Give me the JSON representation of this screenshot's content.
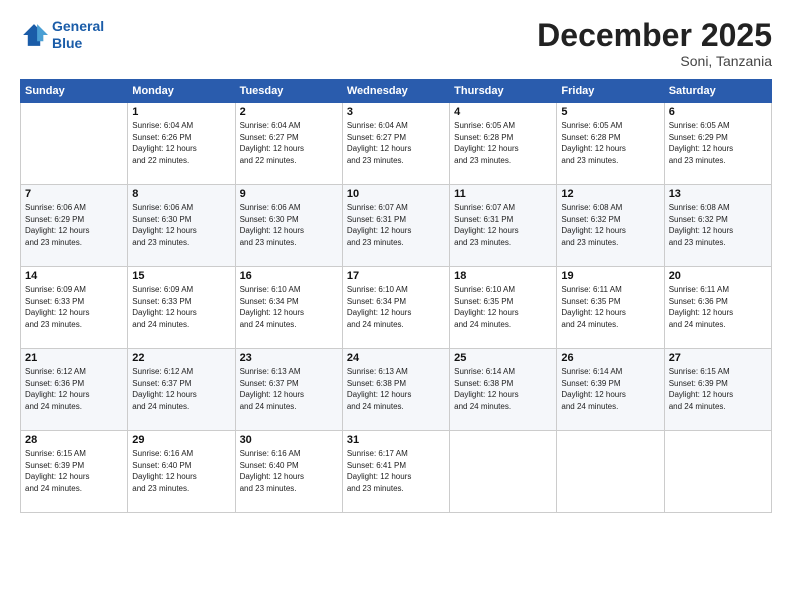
{
  "header": {
    "logo_line1": "General",
    "logo_line2": "Blue",
    "month": "December 2025",
    "location": "Soni, Tanzania"
  },
  "days_of_week": [
    "Sunday",
    "Monday",
    "Tuesday",
    "Wednesday",
    "Thursday",
    "Friday",
    "Saturday"
  ],
  "weeks": [
    [
      {
        "day": "",
        "info": ""
      },
      {
        "day": "1",
        "info": "Sunrise: 6:04 AM\nSunset: 6:26 PM\nDaylight: 12 hours\nand 22 minutes."
      },
      {
        "day": "2",
        "info": "Sunrise: 6:04 AM\nSunset: 6:27 PM\nDaylight: 12 hours\nand 22 minutes."
      },
      {
        "day": "3",
        "info": "Sunrise: 6:04 AM\nSunset: 6:27 PM\nDaylight: 12 hours\nand 23 minutes."
      },
      {
        "day": "4",
        "info": "Sunrise: 6:05 AM\nSunset: 6:28 PM\nDaylight: 12 hours\nand 23 minutes."
      },
      {
        "day": "5",
        "info": "Sunrise: 6:05 AM\nSunset: 6:28 PM\nDaylight: 12 hours\nand 23 minutes."
      },
      {
        "day": "6",
        "info": "Sunrise: 6:05 AM\nSunset: 6:29 PM\nDaylight: 12 hours\nand 23 minutes."
      }
    ],
    [
      {
        "day": "7",
        "info": "Sunrise: 6:06 AM\nSunset: 6:29 PM\nDaylight: 12 hours\nand 23 minutes."
      },
      {
        "day": "8",
        "info": "Sunrise: 6:06 AM\nSunset: 6:30 PM\nDaylight: 12 hours\nand 23 minutes."
      },
      {
        "day": "9",
        "info": "Sunrise: 6:06 AM\nSunset: 6:30 PM\nDaylight: 12 hours\nand 23 minutes."
      },
      {
        "day": "10",
        "info": "Sunrise: 6:07 AM\nSunset: 6:31 PM\nDaylight: 12 hours\nand 23 minutes."
      },
      {
        "day": "11",
        "info": "Sunrise: 6:07 AM\nSunset: 6:31 PM\nDaylight: 12 hours\nand 23 minutes."
      },
      {
        "day": "12",
        "info": "Sunrise: 6:08 AM\nSunset: 6:32 PM\nDaylight: 12 hours\nand 23 minutes."
      },
      {
        "day": "13",
        "info": "Sunrise: 6:08 AM\nSunset: 6:32 PM\nDaylight: 12 hours\nand 23 minutes."
      }
    ],
    [
      {
        "day": "14",
        "info": "Sunrise: 6:09 AM\nSunset: 6:33 PM\nDaylight: 12 hours\nand 23 minutes."
      },
      {
        "day": "15",
        "info": "Sunrise: 6:09 AM\nSunset: 6:33 PM\nDaylight: 12 hours\nand 24 minutes."
      },
      {
        "day": "16",
        "info": "Sunrise: 6:10 AM\nSunset: 6:34 PM\nDaylight: 12 hours\nand 24 minutes."
      },
      {
        "day": "17",
        "info": "Sunrise: 6:10 AM\nSunset: 6:34 PM\nDaylight: 12 hours\nand 24 minutes."
      },
      {
        "day": "18",
        "info": "Sunrise: 6:10 AM\nSunset: 6:35 PM\nDaylight: 12 hours\nand 24 minutes."
      },
      {
        "day": "19",
        "info": "Sunrise: 6:11 AM\nSunset: 6:35 PM\nDaylight: 12 hours\nand 24 minutes."
      },
      {
        "day": "20",
        "info": "Sunrise: 6:11 AM\nSunset: 6:36 PM\nDaylight: 12 hours\nand 24 minutes."
      }
    ],
    [
      {
        "day": "21",
        "info": "Sunrise: 6:12 AM\nSunset: 6:36 PM\nDaylight: 12 hours\nand 24 minutes."
      },
      {
        "day": "22",
        "info": "Sunrise: 6:12 AM\nSunset: 6:37 PM\nDaylight: 12 hours\nand 24 minutes."
      },
      {
        "day": "23",
        "info": "Sunrise: 6:13 AM\nSunset: 6:37 PM\nDaylight: 12 hours\nand 24 minutes."
      },
      {
        "day": "24",
        "info": "Sunrise: 6:13 AM\nSunset: 6:38 PM\nDaylight: 12 hours\nand 24 minutes."
      },
      {
        "day": "25",
        "info": "Sunrise: 6:14 AM\nSunset: 6:38 PM\nDaylight: 12 hours\nand 24 minutes."
      },
      {
        "day": "26",
        "info": "Sunrise: 6:14 AM\nSunset: 6:39 PM\nDaylight: 12 hours\nand 24 minutes."
      },
      {
        "day": "27",
        "info": "Sunrise: 6:15 AM\nSunset: 6:39 PM\nDaylight: 12 hours\nand 24 minutes."
      }
    ],
    [
      {
        "day": "28",
        "info": "Sunrise: 6:15 AM\nSunset: 6:39 PM\nDaylight: 12 hours\nand 24 minutes."
      },
      {
        "day": "29",
        "info": "Sunrise: 6:16 AM\nSunset: 6:40 PM\nDaylight: 12 hours\nand 23 minutes."
      },
      {
        "day": "30",
        "info": "Sunrise: 6:16 AM\nSunset: 6:40 PM\nDaylight: 12 hours\nand 23 minutes."
      },
      {
        "day": "31",
        "info": "Sunrise: 6:17 AM\nSunset: 6:41 PM\nDaylight: 12 hours\nand 23 minutes."
      },
      {
        "day": "",
        "info": ""
      },
      {
        "day": "",
        "info": ""
      },
      {
        "day": "",
        "info": ""
      }
    ]
  ]
}
